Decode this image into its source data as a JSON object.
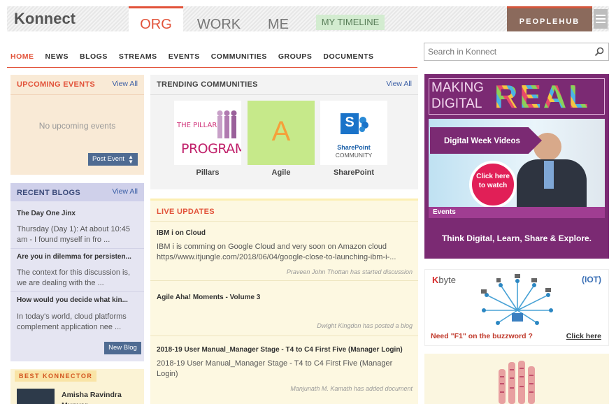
{
  "header": {
    "logo": "Konnect",
    "tabs": [
      "ORG",
      "WORK",
      "ME"
    ],
    "timeline": "MY TIMELINE",
    "peoplehub": "PEOPLEHUB"
  },
  "nav": {
    "items": [
      "HOME",
      "NEWS",
      "BLOGS",
      "STREAMS",
      "EVENTS",
      "COMMUNITIES",
      "GROUPS",
      "DOCUMENTS"
    ],
    "active": "HOME"
  },
  "search": {
    "placeholder": "Search in Konnect"
  },
  "upcoming_events": {
    "title": "UPCOMING EVENTS",
    "view_all": "View All",
    "empty_text": "No upcoming events",
    "post_button": "Post Event"
  },
  "recent_blogs": {
    "title": "RECENT BLOGS",
    "view_all": "View All",
    "items": [
      {
        "title": "The Day One Jinx",
        "excerpt": "Thursday (Day 1): At about  10:45 am - I found myself in fro ..."
      },
      {
        "title": "Are you in dilemma for persisten...",
        "excerpt": "The context for this discussion is, we are dealing with the ..."
      },
      {
        "title": "How would you decide what kin...",
        "excerpt": "In today's world, cloud platforms complement application nee ..."
      }
    ],
    "new_button": "New Blog"
  },
  "best_konnector": {
    "label": "BEST KONNECTOR",
    "name": "Amisha Ravindra Munyar"
  },
  "trending": {
    "title": "TRENDING COMMUNITIES",
    "view_all": "View All",
    "communities": [
      {
        "name": "Pillars",
        "logo_line1": "THE PILLAR",
        "logo_line2": "PROGRAM"
      },
      {
        "name": "Agile",
        "logo_letter": "A"
      },
      {
        "name": "SharePoint",
        "logo_letter": "S",
        "logo_line1": "SharePoint",
        "logo_line2": "COMMUNITY"
      }
    ]
  },
  "live_updates": {
    "title": "LIVE UPDATES",
    "items": [
      {
        "title": "IBM i on Cloud",
        "text": "IBM i is comming on Google Cloud and very soon on Amazon cloud https//www.itjungle.com/2018/06/04/google-close-to-launching-ibm-i-...",
        "meta": "Praveen John Thottan has started discussion"
      },
      {
        "title": "Agile Aha! Moments - Volume 3",
        "text": "",
        "meta": "Dwight Kingdon has posted a blog"
      },
      {
        "title": "2018-19 User Manual_Manager Stage - T4 to C4 First Five (Manager Login)",
        "text": "2018-19 User Manual_Manager Stage - T4 to C4 First Five (Manager Login)",
        "meta": "Manjunath M. Kamath has added document"
      }
    ]
  },
  "banner": {
    "line1": "MAKING",
    "line2": "DIGITAL",
    "word": "REAL",
    "video_label": "Digital Week Videos",
    "click_here": "Click here to watch",
    "events_tag": "Events",
    "tagline": "Think Digital, Learn, Share & Explore."
  },
  "kbyte": {
    "brand_k": "K",
    "brand_rest": "byte",
    "tag": "(IOT)",
    "question": "Need \"F1\" on the buzzword ?",
    "link": "Click here"
  },
  "colors": {
    "accent": "#e2533a",
    "nav_blue": "#4f6b92",
    "banner_purple": "#7b2a73"
  }
}
